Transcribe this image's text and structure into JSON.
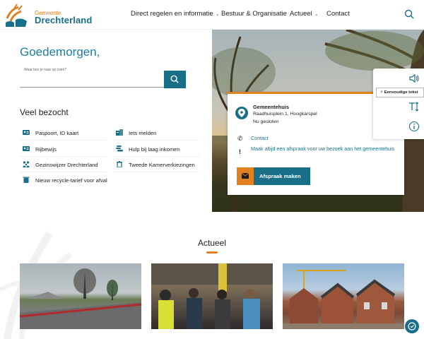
{
  "brand": {
    "small": "Gemeente",
    "name": "Drechterland"
  },
  "nav": [
    {
      "label": "Direct regelen en informatie",
      "dropdown": true
    },
    {
      "label": "Bestuur & Organisatie",
      "dropdown": false
    },
    {
      "label": "Actueel",
      "dropdown": true
    },
    {
      "label": "Contact",
      "dropdown": false
    }
  ],
  "hero": {
    "greeting": "Goedemorgen,",
    "search_label": "Waar ben je naar op zoek?"
  },
  "veel_bezocht": {
    "title": "Veel bezocht",
    "items": [
      {
        "label": "Paspoort, ID kaart",
        "icon": "id-card-icon"
      },
      {
        "label": "Iets melden",
        "icon": "report-icon"
      },
      {
        "label": "Rijbewijs",
        "icon": "id-card-icon"
      },
      {
        "label": "Hulp bij laag inkomen",
        "icon": "coins-icon"
      },
      {
        "label": "Gezinswijzer Drechterland",
        "icon": "family-icon"
      },
      {
        "label": "Tweede Kamerverkiezingen",
        "icon": "ballot-icon"
      },
      {
        "label": "Nieuw recycle-tarief voor afval",
        "icon": "bin-icon"
      }
    ]
  },
  "card": {
    "title": "Gemeentehuis",
    "address": "Raadhuisplein 1, Hoogkarspel",
    "status": "Nu gesloten",
    "contact_link": "Contact",
    "notice": "Maak altijd een afspraak voor uw bezoek aan het gemeentehuis",
    "button": "Afspraak maken"
  },
  "accessibility": {
    "tooltip": "Eenvoudige tekst",
    "icons": [
      "speaker-icon",
      "text-size-icon",
      "info-icon"
    ]
  },
  "actueel": {
    "title": "Actueel"
  },
  "colors": {
    "primary": "#1a6f88",
    "accent": "#e0801e",
    "heading": "#1a7fa0"
  }
}
